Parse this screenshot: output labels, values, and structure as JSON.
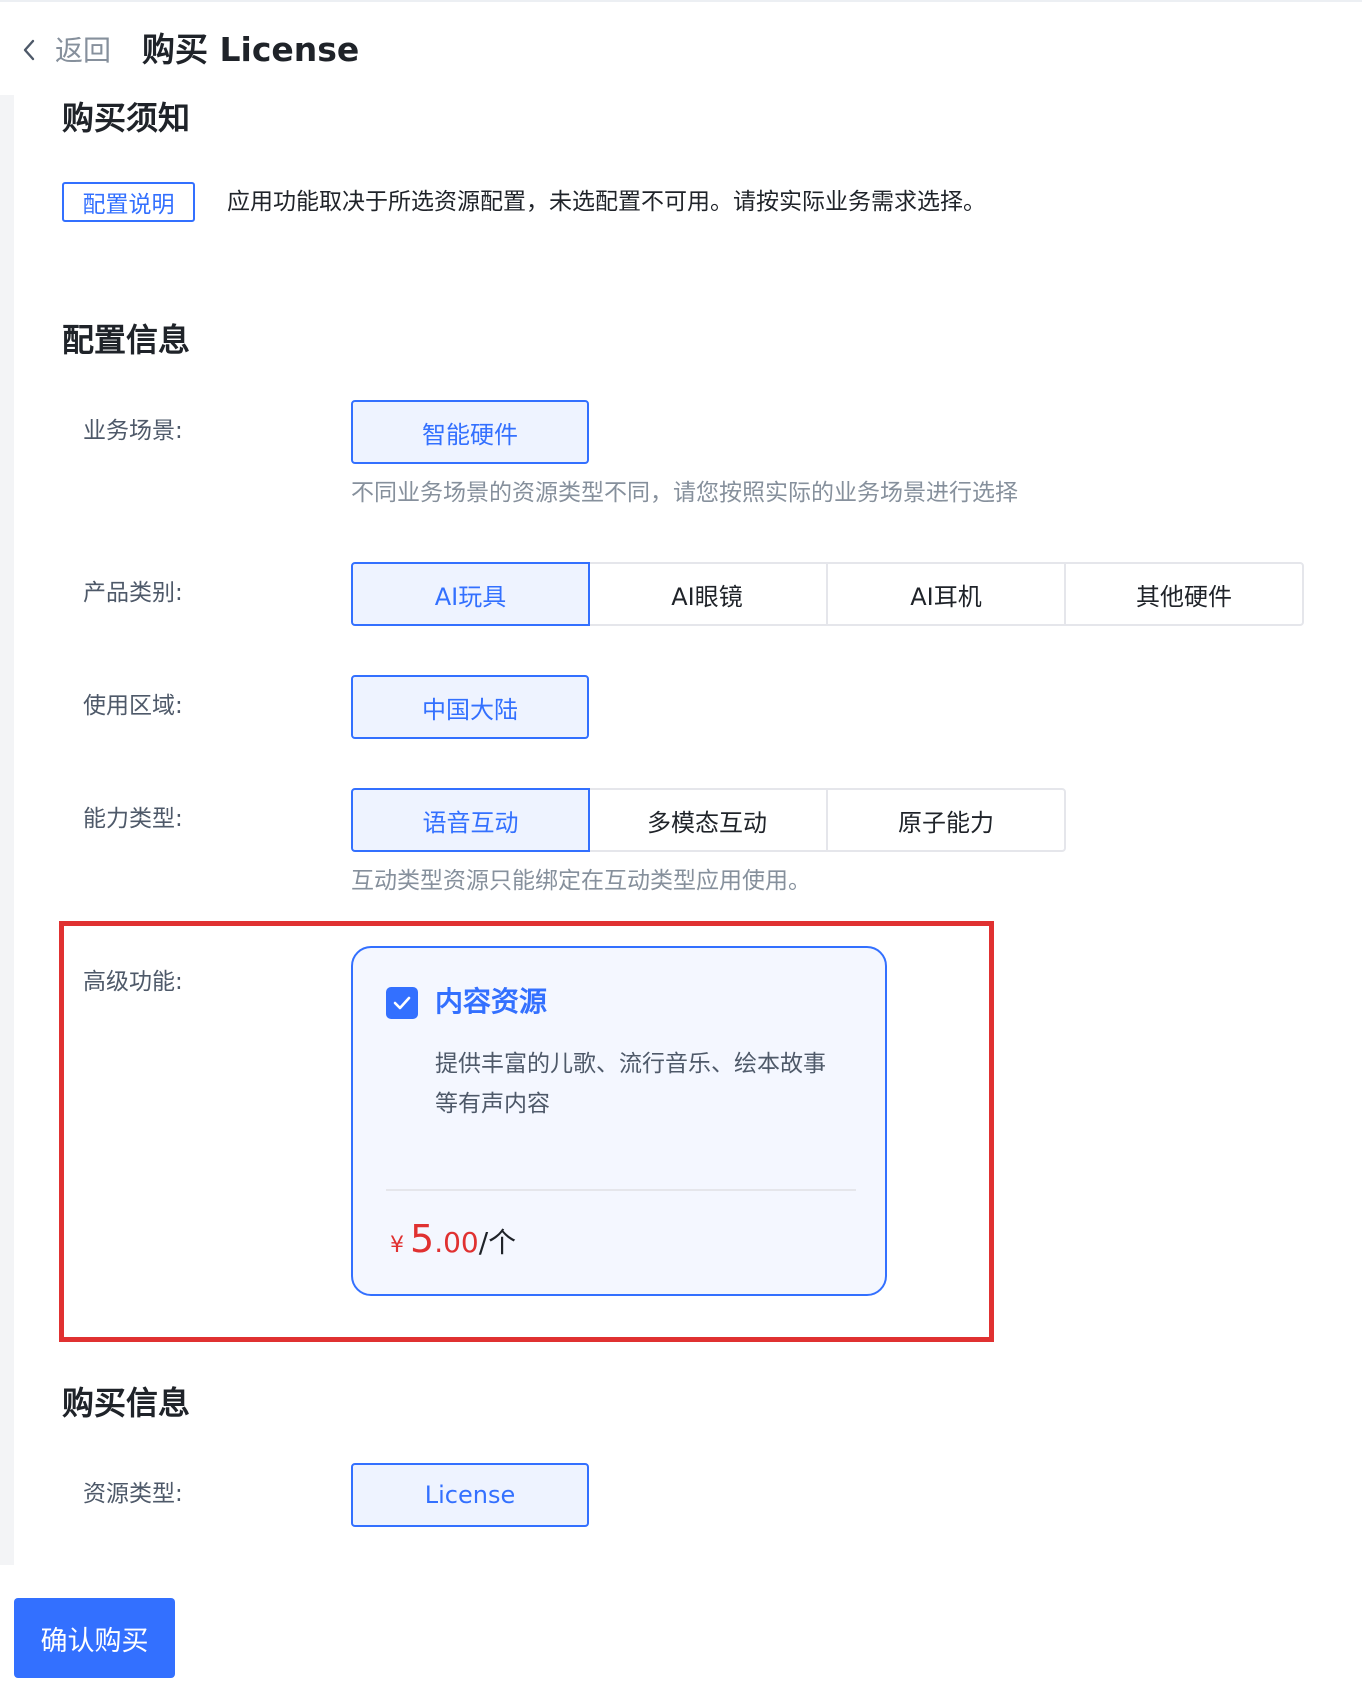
{
  "header": {
    "back_label": "返回",
    "title": "购买 License"
  },
  "notice": {
    "section_title": "购买须知",
    "tag": "配置说明",
    "text": "应用功能取决于所选资源配置，未选配置不可用。请按实际业务需求选择。"
  },
  "config": {
    "section_title": "配置信息",
    "scenario": {
      "label": "业务场景:",
      "options": [
        "智能硬件"
      ],
      "selected": "智能硬件",
      "hint": "不同业务场景的资源类型不同，请您按照实际的业务场景进行选择"
    },
    "product": {
      "label": "产品类别:",
      "options": [
        "AI玩具",
        "AI眼镜",
        "AI耳机",
        "其他硬件"
      ],
      "selected": "AI玩具"
    },
    "region": {
      "label": "使用区域:",
      "options": [
        "中国大陆"
      ],
      "selected": "中国大陆"
    },
    "capability": {
      "label": "能力类型:",
      "options": [
        "语音互动",
        "多模态互动",
        "原子能力"
      ],
      "selected": "语音互动",
      "hint": "互动类型资源只能绑定在互动类型应用使用。"
    },
    "advanced": {
      "label": "高级功能:",
      "card": {
        "title": "内容资源",
        "checked": true,
        "desc_line1": "提供丰富的儿歌、流行音乐、绘本故事",
        "desc_line2": "等有声内容",
        "currency": "¥",
        "price_int": "5",
        "price_dec": ".00",
        "unit": "/个"
      }
    }
  },
  "purchase": {
    "section_title": "购买信息",
    "resource_type": {
      "label": "资源类型:",
      "options": [
        "License"
      ],
      "selected": "License"
    }
  },
  "actions": {
    "confirm_label": "确认购买"
  },
  "colors": {
    "primary": "#3370ff",
    "selected_bg": "#eef3ff",
    "price": "#e03131",
    "highlight_frame": "#e03131"
  }
}
